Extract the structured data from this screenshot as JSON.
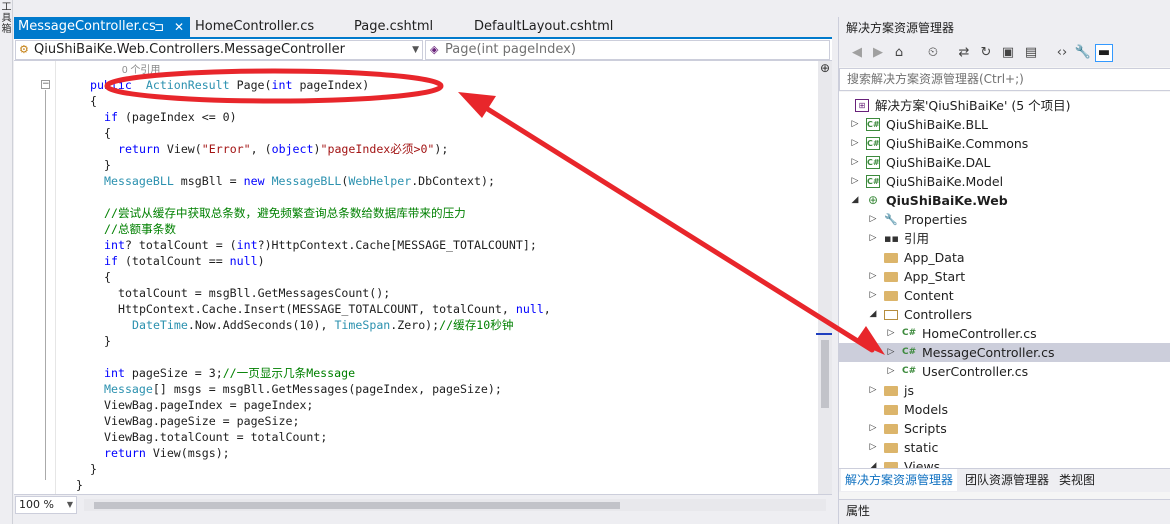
{
  "left_toolwin": {
    "chars": [
      "工",
      "具",
      "箱"
    ]
  },
  "editor_tabs": [
    {
      "label": "MessageController.cs",
      "pin": "⊐",
      "close": "✕"
    },
    {
      "label": "HomeController.cs"
    },
    {
      "label": "Page.cshtml"
    },
    {
      "label": "DefaultLayout.cshtml"
    }
  ],
  "navbar": {
    "class_scope": "QiuShiBaiKe.Web.Controllers.MessageController",
    "member_scope": "Page(int pageIndex)"
  },
  "code": {
    "references": "0 个引用",
    "lines": [
      [
        [
          "kw",
          "public"
        ],
        [
          "",
          "  "
        ],
        [
          "ty",
          "ActionResult"
        ],
        [
          "",
          " Page("
        ],
        [
          "kw",
          "int"
        ],
        [
          "",
          " pageIndex)"
        ]
      ],
      [
        [
          "",
          "{"
        ]
      ],
      [
        [
          "kw",
          "if"
        ],
        [
          "",
          " (pageIndex <= 0)"
        ]
      ],
      [
        [
          "",
          "{"
        ]
      ],
      [
        [
          "kw",
          "return"
        ],
        [
          "",
          " View("
        ],
        [
          "st",
          "\"Error\""
        ],
        [
          "",
          ", ("
        ],
        [
          "kw",
          "object"
        ],
        [
          "",
          ")"
        ],
        [
          "st",
          "\"pageIndex必须>0\""
        ],
        [
          "",
          ");"
        ]
      ],
      [
        [
          "",
          "}"
        ]
      ],
      [
        [
          "ty",
          "MessageBLL"
        ],
        [
          "",
          " msgBll = "
        ],
        [
          "kw",
          "new"
        ],
        [
          "",
          " "
        ],
        [
          "ty",
          "MessageBLL"
        ],
        [
          "",
          "("
        ],
        [
          "ty",
          "WebHelper"
        ],
        [
          "",
          ".DbContext);"
        ]
      ],
      [],
      [
        [
          "cm",
          "//尝试从缓存中获取总条数，避免频繁查询总条数给数据库带来的压力"
        ]
      ],
      [
        [
          "cm",
          "//总额事条数"
        ]
      ],
      [
        [
          "kw",
          "int"
        ],
        [
          "",
          "? totalCount = ("
        ],
        [
          "kw",
          "int"
        ],
        [
          "",
          "?)HttpContext.Cache[MESSAGE_TOTALCOUNT];"
        ]
      ],
      [
        [
          "kw",
          "if"
        ],
        [
          "",
          " (totalCount == "
        ],
        [
          "kw",
          "null"
        ],
        [
          "",
          ")"
        ]
      ],
      [
        [
          "",
          "{"
        ]
      ],
      [
        [
          "",
          "totalCount = msgBll.GetMessagesCount();"
        ]
      ],
      [
        [
          "",
          "HttpContext.Cache.Insert(MESSAGE_TOTALCOUNT, totalCount, "
        ],
        [
          "kw",
          "null"
        ],
        [
          "",
          ","
        ]
      ],
      [
        [
          "ty",
          "DateTime"
        ],
        [
          "",
          ".Now.AddSeconds(10), "
        ],
        [
          "ty",
          "TimeSpan"
        ],
        [
          "",
          ".Zero);"
        ],
        [
          "cm",
          "//缓存10秒钟"
        ]
      ],
      [
        [
          "",
          "}"
        ]
      ],
      [],
      [
        [
          "kw",
          "int"
        ],
        [
          "",
          " pageSize = 3;"
        ],
        [
          "cm",
          "//一页显示几条Message"
        ]
      ],
      [
        [
          "ty",
          "Message"
        ],
        [
          "",
          "[] msgs = msgBll.GetMessages(pageIndex, pageSize);"
        ]
      ],
      [
        [
          "",
          "ViewBag.pageIndex = pageIndex;"
        ]
      ],
      [
        [
          "",
          "ViewBag.pageSize = pageSize;"
        ]
      ],
      [
        [
          "",
          "ViewBag.totalCount = totalCount;"
        ]
      ],
      [
        [
          "kw",
          "return"
        ],
        [
          "",
          " View(msgs);"
        ]
      ],
      [
        [
          "",
          "}"
        ]
      ],
      [
        [
          "",
          "}"
        ]
      ]
    ]
  },
  "statusbar": {
    "zoom": "100 %"
  },
  "solution_explorer": {
    "title": "解决方案资源管理器",
    "search_placeholder": "搜索解决方案资源管理器(Ctrl+;)",
    "toolbar_icons": [
      "back-icon",
      "forward-icon",
      "home-icon",
      "history-icon",
      "sync-icon",
      "refresh-icon",
      "collapse-all-icon",
      "show-files-icon",
      "view-code-icon",
      "properties-icon",
      "preview-icon"
    ],
    "tree": [
      {
        "label": "解决方案'QiuShiBaiKe' (5 个项目)",
        "icon": "solution-icon",
        "depth": 0,
        "expander": ""
      },
      {
        "label": "QiuShiBaiKe.BLL",
        "icon": "csharp-project-icon",
        "depth": 1,
        "expander": "▷"
      },
      {
        "label": "QiuShiBaiKe.Commons",
        "icon": "csharp-project-icon",
        "depth": 1,
        "expander": "▷"
      },
      {
        "label": "QiuShiBaiKe.DAL",
        "icon": "csharp-project-icon",
        "depth": 1,
        "expander": "▷"
      },
      {
        "label": "QiuShiBaiKe.Model",
        "icon": "csharp-project-icon",
        "depth": 1,
        "expander": "▷"
      },
      {
        "label": "QiuShiBaiKe.Web",
        "icon": "web-project-icon",
        "depth": 1,
        "expander": "◢",
        "bold": true
      },
      {
        "label": "Properties",
        "icon": "wrench-icon",
        "depth": 2,
        "expander": "▷"
      },
      {
        "label": "引用",
        "icon": "references-icon",
        "depth": 2,
        "expander": "▷"
      },
      {
        "label": "App_Data",
        "icon": "folder-icon",
        "depth": 2,
        "expander": ""
      },
      {
        "label": "App_Start",
        "icon": "folder-icon",
        "depth": 2,
        "expander": "▷"
      },
      {
        "label": "Content",
        "icon": "folder-icon",
        "depth": 2,
        "expander": "▷"
      },
      {
        "label": "Controllers",
        "icon": "folder-open-icon",
        "depth": 2,
        "expander": "◢"
      },
      {
        "label": "HomeController.cs",
        "icon": "csharp-file-icon",
        "depth": 3,
        "expander": "▷"
      },
      {
        "label": "MessageController.cs",
        "icon": "csharp-file-icon",
        "depth": 3,
        "expander": "▷",
        "selected": true
      },
      {
        "label": "UserController.cs",
        "icon": "csharp-file-icon",
        "depth": 3,
        "expander": "▷"
      },
      {
        "label": "js",
        "icon": "folder-icon",
        "depth": 2,
        "expander": "▷"
      },
      {
        "label": "Models",
        "icon": "folder-icon",
        "depth": 2,
        "expander": ""
      },
      {
        "label": "Scripts",
        "icon": "folder-icon",
        "depth": 2,
        "expander": "▷"
      },
      {
        "label": "static",
        "icon": "folder-icon",
        "depth": 2,
        "expander": "▷"
      },
      {
        "label": "Views",
        "icon": "folder-icon",
        "depth": 2,
        "expander": "◢"
      }
    ],
    "bottom_tabs": [
      "解决方案资源管理器",
      "团队资源管理器",
      "类视图"
    ]
  },
  "properties_panel": {
    "title": "属性"
  },
  "colors": {
    "accent": "#007acc",
    "annotation": "#e8262b",
    "selection": "#cccedb"
  }
}
